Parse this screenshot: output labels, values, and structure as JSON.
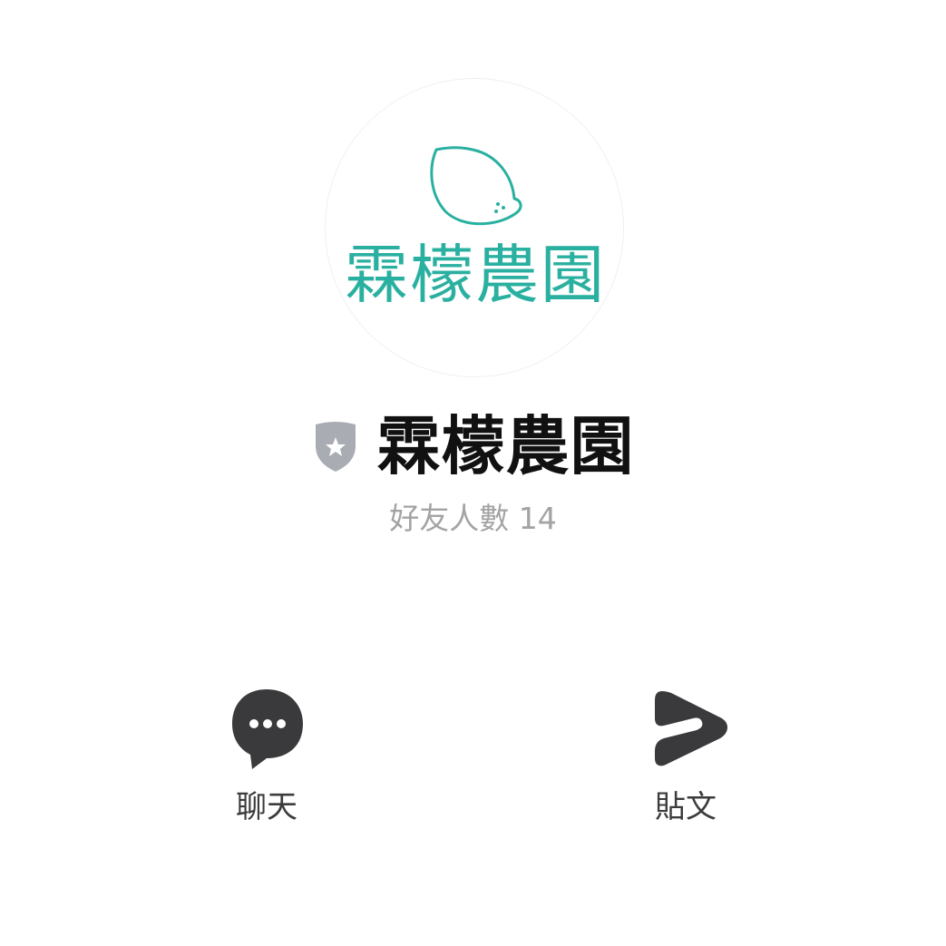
{
  "profile": {
    "avatar_text": "霖檬農園",
    "name": "霖檬農園",
    "friends_count": "好友人數 14",
    "brand_color": "#2ab0a0",
    "badge_icon": "shield-star-icon"
  },
  "actions": [
    {
      "label": "聊天",
      "icon": "chat-bubble-icon"
    },
    {
      "label": "貼文",
      "icon": "play-post-icon"
    }
  ],
  "colors": {
    "icon_dark": "#3a3a3c",
    "badge_gray": "#a9adb3",
    "subtext": "#a3a3a3"
  }
}
